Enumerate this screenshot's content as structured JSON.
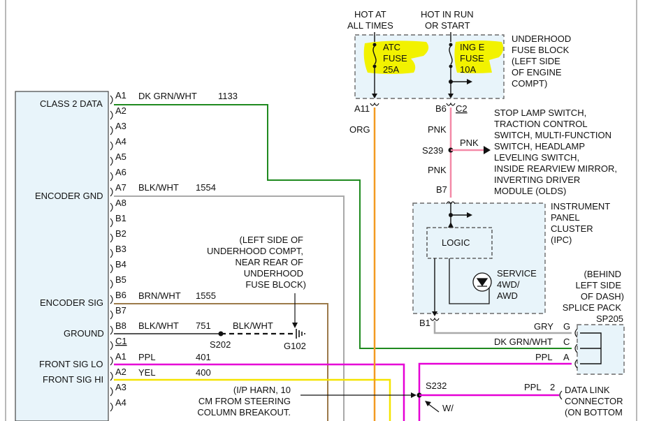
{
  "power": {
    "hot_at_all_times": [
      "HOT AT",
      "ALL TIMES"
    ],
    "hot_in_run": [
      "HOT IN RUN",
      "OR START"
    ]
  },
  "fuse_block": {
    "label": [
      "UNDERHOOD",
      "FUSE BLOCK",
      "(LEFT SIDE",
      "OF ENGINE",
      "COMPT)"
    ],
    "fuse1": [
      "ATC",
      "FUSE",
      "25A"
    ],
    "fuse2": [
      "ING E",
      "FUSE",
      "10A"
    ],
    "pin_a11": "A11",
    "pin_b6": "B6",
    "conn_c2": "C2",
    "highlight_color": "#f2f200"
  },
  "wires": {
    "org": "ORG",
    "pnk_upper": "PNK",
    "pnk_splice": "PNK",
    "pnk_lower": "PNK",
    "splice_s239": "S239",
    "pin_b7": "B7",
    "pin_b1": "B1"
  },
  "switch_list": [
    "STOP LAMP SWITCH,",
    "TRACTION CONTROL",
    "SWITCH, MULTI-FUNCTION",
    "SWITCH, HEADLAMP",
    "LEVELING SWITCH,",
    "INSIDE REARVIEW MIRROR,",
    "INVERTING DRIVER",
    "MODULE (OLDS)"
  ],
  "ipc": {
    "label": [
      "INSTRUMENT",
      "PANEL",
      "CLUSTER",
      "(IPC)"
    ],
    "logic": "LOGIC",
    "service": [
      "SERVICE",
      "4WD/",
      "AWD"
    ]
  },
  "module_pins": {
    "labels": [
      "CLASS 2 DATA",
      "ENCODER GND",
      "ENCODER SIG",
      "GROUND",
      "FRONT SIG LO",
      "FRONT SIG HI"
    ],
    "pins": [
      "A1",
      "A2",
      "A3",
      "A4",
      "A5",
      "A6",
      "A7",
      "A8",
      "B1",
      "B2",
      "B3",
      "B4",
      "B5",
      "B6",
      "B7",
      "B8",
      "C1",
      "A1",
      "A2",
      "A3",
      "A4"
    ]
  },
  "circuits": [
    {
      "color_name": "DK GRN/WHT",
      "num": "1133"
    },
    {
      "color_name": "BLK/WHT",
      "num": "1554"
    },
    {
      "color_name": "BRN/WHT",
      "num": "1555"
    },
    {
      "color_name": "BLK/WHT",
      "num": "751"
    },
    {
      "color_name": "PPL",
      "num": "401"
    },
    {
      "color_name": "YEL",
      "num": "400"
    }
  ],
  "ground": {
    "s202": "S202",
    "blkwht": "BLK/WHT",
    "g102": "G102",
    "note": [
      "(LEFT SIDE OF",
      "UNDERHOOD COMPT,",
      "NEAR REAR OF",
      "UNDERHOOD",
      "FUSE BLOCK)"
    ]
  },
  "splice_pack": {
    "note": [
      "(BEHIND",
      "LEFT SIDE",
      "OF DASH)",
      "SPLICE PACK"
    ],
    "id": "SP205",
    "rows": [
      {
        "wire": "GRY",
        "pin": "G"
      },
      {
        "wire": "DK GRN/WHT",
        "pin": "C"
      },
      {
        "wire": "PPL",
        "pin": "A"
      }
    ]
  },
  "bottom": {
    "s232": "S232",
    "w": "W/",
    "ppl": "PPL",
    "pin2": "2",
    "ip_harn": [
      "(I/P HARN, 10",
      "CM FROM STEERING",
      "COLUMN BREAKOUT."
    ],
    "dlc": [
      "DATA LINK",
      "CONNECTOR",
      "(ON BOTTOM"
    ]
  },
  "colors": {
    "green": "#1f8a1f",
    "orange": "#f39a21",
    "pink": "#f48aa8",
    "magenta": "#e600d6",
    "yellow": "#f5e400",
    "brown": "#9b7a4a",
    "gray": "#a9a9a9",
    "panel": "#e8f4fa"
  }
}
